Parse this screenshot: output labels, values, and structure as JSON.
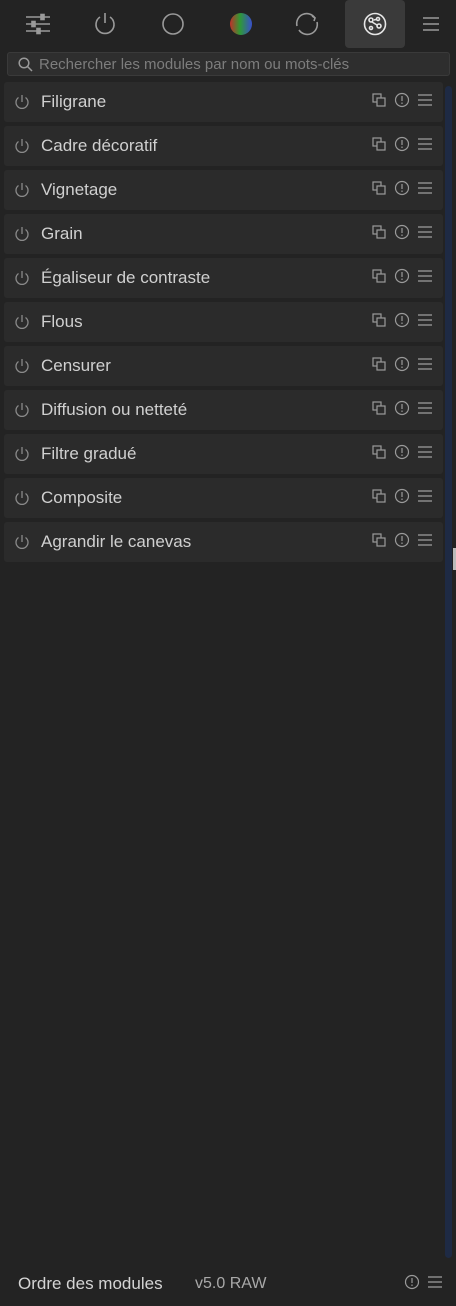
{
  "tabs": [
    {
      "icon": "sliders-icon",
      "active": false
    },
    {
      "icon": "power-icon",
      "active": false
    },
    {
      "icon": "circle-icon",
      "active": false
    },
    {
      "icon": "color-wheel-icon",
      "active": false
    },
    {
      "icon": "refresh-icon",
      "active": false
    },
    {
      "icon": "effects-icon",
      "active": true
    },
    {
      "icon": "menu-icon",
      "active": false
    }
  ],
  "search": {
    "placeholder": "Rechercher les modules par nom ou mots-clés"
  },
  "modules": [
    {
      "name": "Filigrane"
    },
    {
      "name": "Cadre décoratif"
    },
    {
      "name": "Vignetage"
    },
    {
      "name": "Grain"
    },
    {
      "name": "Égaliseur de contraste"
    },
    {
      "name": "Flous"
    },
    {
      "name": "Censurer"
    },
    {
      "name": "Diffusion ou netteté"
    },
    {
      "name": "Filtre gradué"
    },
    {
      "name": "Composite"
    },
    {
      "name": "Agrandir le canevas"
    }
  ],
  "footer": {
    "label": "Ordre des modules",
    "version": "v5.0 RAW"
  },
  "colors": {
    "background": "#232323",
    "module_bg": "#2b2b2b",
    "active_tab": "#3a3a3a",
    "scrollbar": "#1e2a44"
  }
}
